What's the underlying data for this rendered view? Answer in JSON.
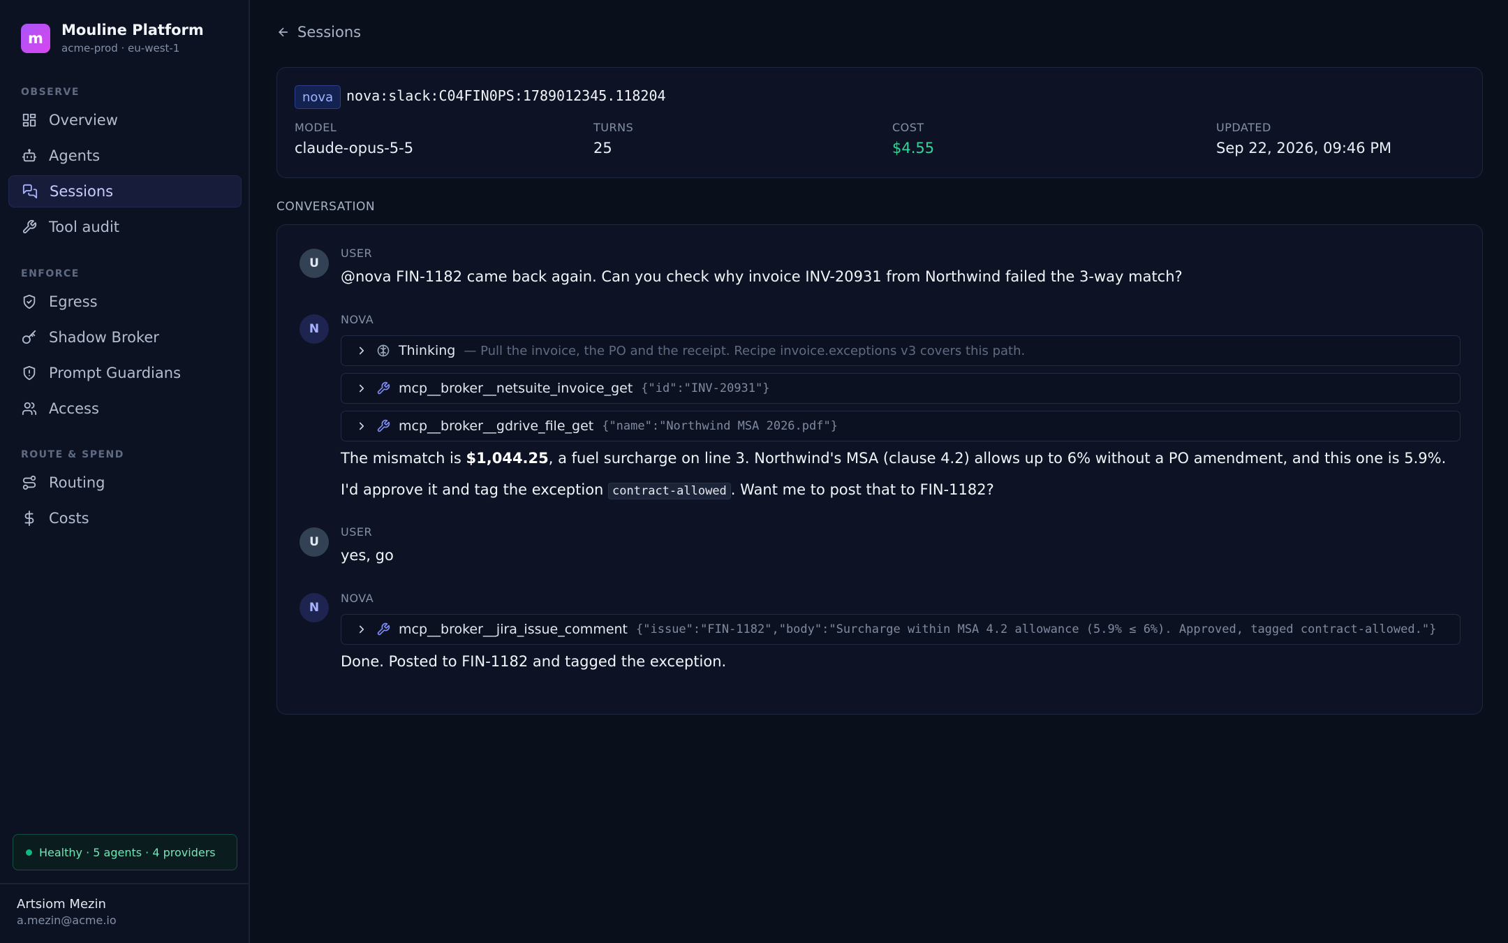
{
  "brand": {
    "logo_letter": "m",
    "name": "Mouline Platform",
    "subtitle": "acme-prod · eu-west-1"
  },
  "nav": {
    "sections": [
      {
        "label": "OBSERVE",
        "items": [
          {
            "label": "Overview",
            "icon": "grid-icon"
          },
          {
            "label": "Agents",
            "icon": "bot-icon"
          },
          {
            "label": "Sessions",
            "icon": "chat-icon",
            "active": true
          },
          {
            "label": "Tool audit",
            "icon": "wrench-icon"
          }
        ]
      },
      {
        "label": "ENFORCE",
        "items": [
          {
            "label": "Egress",
            "icon": "shield-check-icon"
          },
          {
            "label": "Shadow Broker",
            "icon": "key-icon"
          },
          {
            "label": "Prompt Guardians",
            "icon": "shield-alert-icon"
          },
          {
            "label": "Access",
            "icon": "users-icon"
          }
        ]
      },
      {
        "label": "ROUTE & SPEND",
        "items": [
          {
            "label": "Routing",
            "icon": "route-icon"
          },
          {
            "label": "Costs",
            "icon": "dollar-icon"
          }
        ]
      }
    ]
  },
  "status": {
    "text": "Healthy · 5 agents · 4 providers",
    "color": "#10b981"
  },
  "user": {
    "name": "Artsiom Mezin",
    "email": "a.mezin@acme.io"
  },
  "header": {
    "back_label": "Sessions"
  },
  "session": {
    "agent": "nova",
    "id": "nova:slack:C04FIN0PS:1789012345.118204",
    "meta": [
      {
        "label": "MODEL",
        "value": "claude-opus-5-5"
      },
      {
        "label": "TURNS",
        "value": "25"
      },
      {
        "label": "COST",
        "value": "$4.55"
      },
      {
        "label": "UPDATED",
        "value": "Sep 22, 2026, 09:46 PM"
      }
    ]
  },
  "conversation": {
    "label": "CONVERSATION",
    "messages": [
      {
        "role": "USER",
        "avatar": "U",
        "text": "@nova FIN-1182 came back again. Can you check why invoice INV-20931 from Northwind failed the 3-way match?"
      },
      {
        "role": "NOVA",
        "avatar": "N",
        "thinking": {
          "label": "Thinking",
          "text": "— Pull the invoice, the PO and the receipt. Recipe invoice.exceptions v3 covers this path."
        },
        "tools": [
          {
            "name": "mcp__broker__netsuite_invoice_get",
            "args": "{\"id\":\"INV-20931\"}"
          },
          {
            "name": "mcp__broker__gdrive_file_get",
            "args": "{\"name\":\"Northwind MSA 2026.pdf\"}"
          }
        ],
        "p1_before": "The mismatch is ",
        "p1_bold": "$1,044.25",
        "p1_after": ", a fuel surcharge on line 3. Northwind's MSA (clause 4.2) allows up to 6% without a PO amendment, and this one is 5.9%.",
        "p2_before": "I'd approve it and tag the exception ",
        "p2_code": "contract-allowed",
        "p2_after": ". Want me to post that to FIN-1182?"
      },
      {
        "role": "USER",
        "avatar": "U",
        "text": "yes, go"
      },
      {
        "role": "NOVA",
        "avatar": "N",
        "tools": [
          {
            "name": "mcp__broker__jira_issue_comment",
            "args": "{\"issue\":\"FIN-1182\",\"body\":\"Surcharge within MSA 4.2 allowance (5.9% ≤ 6%). Approved, tagged contract-allowed.\"}"
          }
        ],
        "text": "Done. Posted to FIN-1182 and tagged the exception."
      }
    ]
  }
}
